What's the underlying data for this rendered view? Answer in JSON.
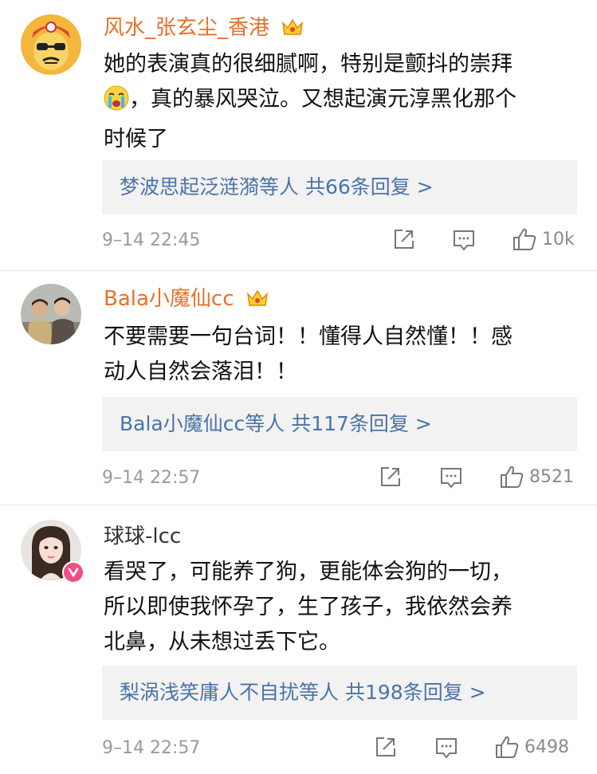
{
  "comments": [
    {
      "username": "风水_张玄尘_香港",
      "text_part1": "她的表演真的很细腻啊，特别是颤抖的崇拜",
      "text_part2": "，真的暴风哭泣。又想起演元淳黑化那个",
      "text_part3": "时候了",
      "reply_names": "梦波思起泛涟漪",
      "reply_mid": "等人",
      "reply_count": "共66条回复 >",
      "time": "9–14 22:45",
      "likes": "10k"
    },
    {
      "username": "Bala小魔仙cc",
      "text_line1": "不要需要一句台词！！懂得人自然懂！！感",
      "text_line2": "动人自然会落泪！！",
      "reply_names": "Bala小魔仙cc",
      "reply_mid": "等人",
      "reply_count": "共117条回复 >",
      "time": "9–14 22:57",
      "likes": "8521"
    },
    {
      "username": "球球-lcc",
      "text_line1": "看哭了，可能养了狗，更能体会狗的一切，",
      "text_line2": "所以即使我怀孕了，生了孩子，我依然会养",
      "text_line3": "北鼻，从未想过丢下它。",
      "reply_names": "梨涡浅笑庸人不自扰",
      "reply_mid": "等人",
      "reply_count": "共198条回复 >",
      "time": "9–14 22:57",
      "likes": "6498"
    }
  ]
}
